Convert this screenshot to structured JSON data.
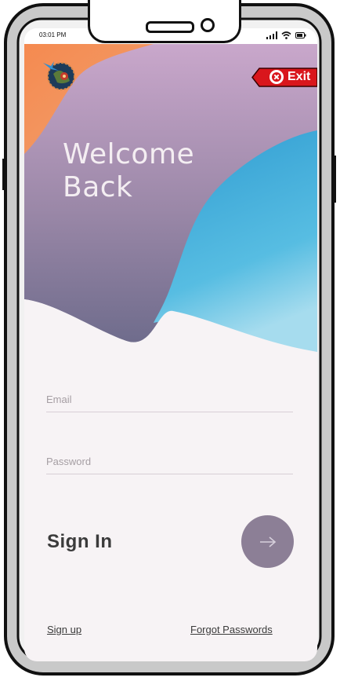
{
  "status_bar": {
    "time": "03:01 PM",
    "icons": [
      "signal-icon",
      "wifi-icon",
      "battery-icon"
    ]
  },
  "header": {
    "logo_icon": "globe-plane-logo",
    "exit_label": "Exit",
    "exit_icon": "close-circle-icon"
  },
  "hero": {
    "title_line1": "Welcome",
    "title_line2": "Back"
  },
  "form": {
    "email_placeholder": "Email",
    "email_value": "",
    "password_placeholder": "Password",
    "password_value": "",
    "title": "Sign In",
    "submit_icon": "arrow-right-icon"
  },
  "footer": {
    "signup_label": "Sign up",
    "forgot_label": "Forgot Passwords"
  },
  "colors": {
    "orange": "#f3935c",
    "purple_top": "#c7a3c8",
    "purple_dark": "#7b6f8f",
    "blue": "#3fa7d6",
    "light_blue": "#8fd3ea",
    "button": "#8c7f96",
    "exit_red": "#d9161c",
    "background": "#f7f3f5"
  }
}
